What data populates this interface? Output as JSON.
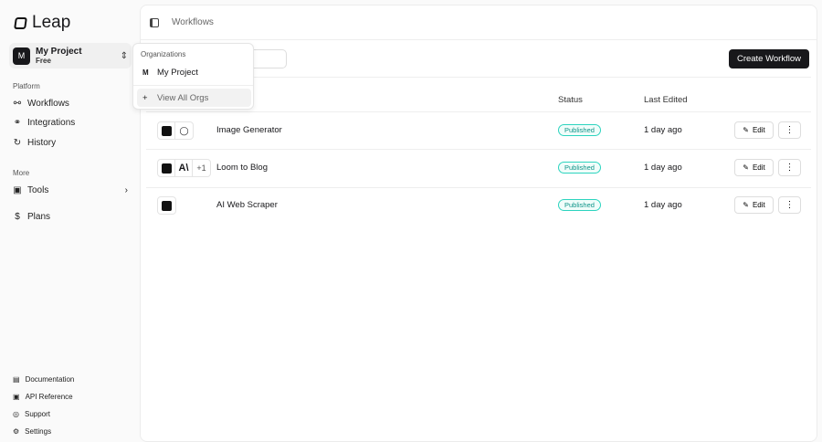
{
  "brand": "Leap",
  "project": {
    "initial": "M",
    "name": "My Project",
    "plan": "Free"
  },
  "sidebar": {
    "platform_label": "Platform",
    "platform": [
      {
        "label": "Workflows",
        "icon": "workflow-icon"
      },
      {
        "label": "Integrations",
        "icon": "integrations-icon"
      },
      {
        "label": "History",
        "icon": "history-icon"
      }
    ],
    "more_label": "More",
    "tools": "Tools",
    "plans": "Plans",
    "footer": [
      "Documentation",
      "API Reference",
      "Support",
      "Settings"
    ]
  },
  "breadcrumb": "Workflows",
  "create_label": "Create Workflow",
  "table": {
    "headers": {
      "status": "Status",
      "edited": "Last Edited"
    },
    "rows": [
      {
        "name": "Image Generator",
        "status": "Published",
        "edited": "1 day ago",
        "extra": ""
      },
      {
        "name": "Loom to Blog",
        "status": "Published",
        "edited": "1 day ago",
        "extra": "+1"
      },
      {
        "name": "AI Web Scraper",
        "status": "Published",
        "edited": "1 day ago",
        "extra": ""
      }
    ],
    "edit_label": "Edit"
  },
  "dropdown": {
    "header": "Organizations",
    "org_initial": "M",
    "org": "My Project",
    "view_all": "View All Orgs"
  }
}
